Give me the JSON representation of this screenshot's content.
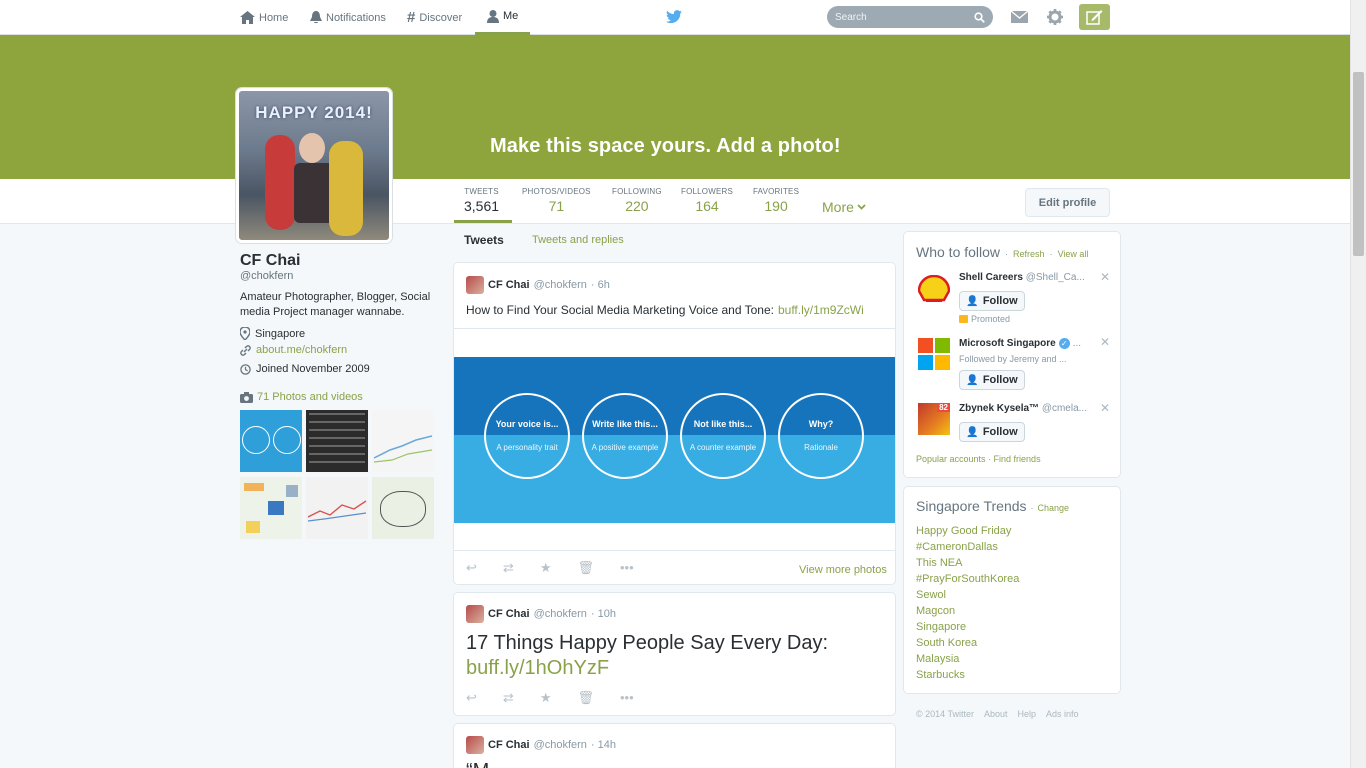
{
  "nav": {
    "items": [
      {
        "label": "Home",
        "icon": "home-icon"
      },
      {
        "label": "Notifications",
        "icon": "bell-icon"
      },
      {
        "label": "Discover",
        "icon": "hash-icon"
      },
      {
        "label": "Me",
        "icon": "person-icon"
      }
    ],
    "search_placeholder": "Search"
  },
  "banner": {
    "text": "Make this space yours. Add a photo!"
  },
  "avatar": {
    "caption": "HAPPY 2014!"
  },
  "stats": [
    {
      "label": "TWEETS",
      "value": "3,561"
    },
    {
      "label": "PHOTOS/VIDEOS",
      "value": "71"
    },
    {
      "label": "FOLLOWING",
      "value": "220"
    },
    {
      "label": "FOLLOWERS",
      "value": "164"
    },
    {
      "label": "FAVORITES",
      "value": "190"
    }
  ],
  "more_label": "More",
  "edit_profile_label": "Edit profile",
  "profile": {
    "name": "CF Chai",
    "handle": "@chokfern",
    "bio": "Amateur Photographer, Blogger, Social media Project manager wannabe.",
    "location": "Singapore",
    "url": "about.me/chokfern",
    "joined": "Joined November 2009",
    "photos_label": "71 Photos and videos"
  },
  "tabs": {
    "tweets": "Tweets",
    "replies": "Tweets and replies"
  },
  "tweets": [
    {
      "name": "CF Chai",
      "handle": "@chokfern",
      "time": "· 6h",
      "text": "How to Find Your Social Media Marketing Voice and Tone:",
      "link": "buff.ly/1m9ZcWi",
      "view_more": "View more photos",
      "image_circles": [
        {
          "title": "Your voice is...",
          "sub": "A personality trait"
        },
        {
          "title": "Write like this...",
          "sub": "A positive example"
        },
        {
          "title": "Not like this...",
          "sub": "A counter example"
        },
        {
          "title": "Why?",
          "sub": "Rationale"
        }
      ]
    },
    {
      "name": "CF Chai",
      "handle": "@chokfern",
      "time": "· 10h",
      "text": "17 Things Happy People Say Every Day:",
      "link": "buff.ly/1hOhYzF"
    },
    {
      "name": "CF Chai",
      "handle": "@chokfern",
      "time": "· 14h",
      "text": "“M"
    }
  ],
  "who_to_follow": {
    "title": "Who to follow",
    "refresh": "Refresh",
    "view_all": "View all",
    "follow_label": "Follow",
    "accounts": [
      {
        "name": "Shell Careers",
        "handle": "@Shell_Ca...",
        "meta": "Promoted"
      },
      {
        "name": "Microsoft Singapore",
        "handle": "...",
        "meta": "Followed by Jeremy and ..."
      },
      {
        "name": "Zbynek Kysela™",
        "handle": "@cmela...",
        "meta": ""
      }
    ],
    "footer": "Popular accounts · Find friends"
  },
  "trends": {
    "title": "Singapore Trends",
    "change": "Change",
    "items": [
      "Happy Good Friday",
      "#CameronDallas",
      "This NEA",
      "#PrayForSouthKorea",
      "Sewol",
      "Magcon",
      "Singapore",
      "South Korea",
      "Malaysia",
      "Starbucks"
    ]
  },
  "footer": {
    "copyright": "© 2014 Twitter",
    "about": "About",
    "help": "Help",
    "ads": "Ads info"
  },
  "colors": {
    "accent": "#89a24a",
    "banner": "#8ea43c",
    "info_dark": "#1a73ba",
    "info_light": "#3aaee4"
  }
}
